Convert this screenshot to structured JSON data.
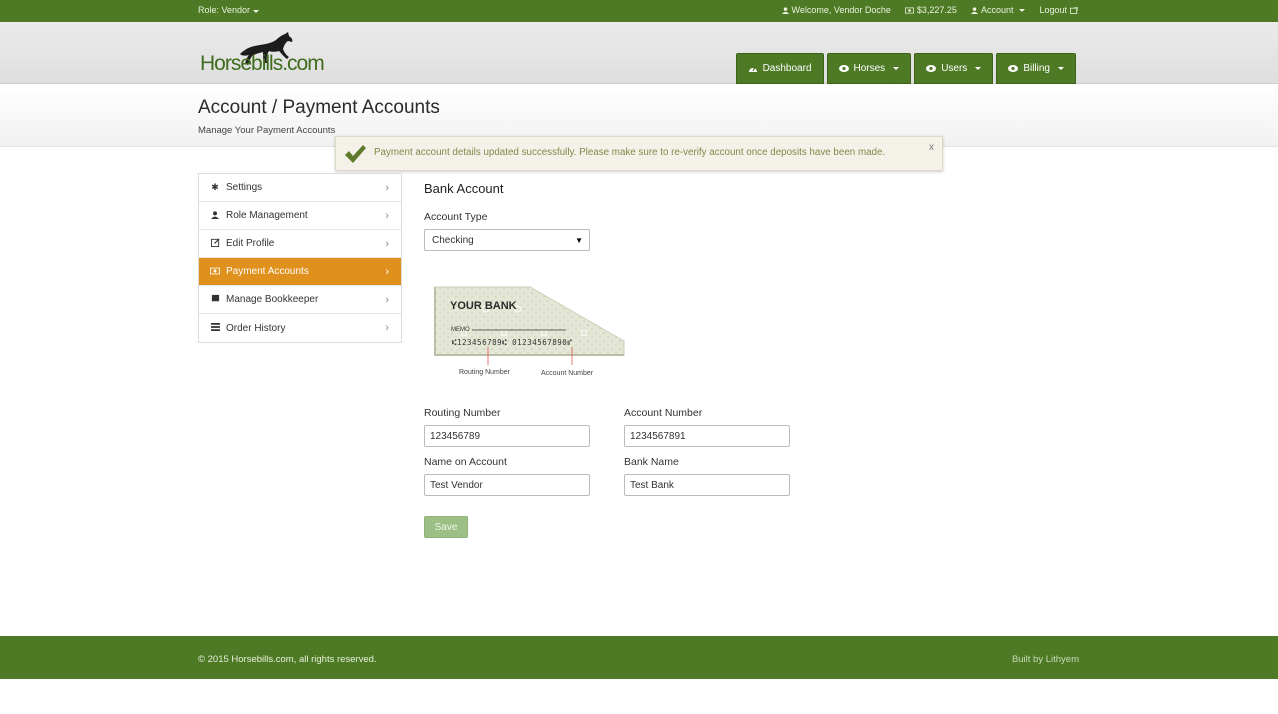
{
  "topbar": {
    "role": "Role: Vendor",
    "welcome": "Welcome, Vendor Doche",
    "balance": "$3,227.25",
    "account": "Account",
    "logout": "Logout"
  },
  "brand": {
    "logo_text": "Horsebills.com"
  },
  "nav": {
    "dashboard": "Dashboard",
    "horses": "Horses",
    "users": "Users",
    "billing": "Billing"
  },
  "page": {
    "title": "Account / Payment Accounts",
    "subtitle": "Manage Your Payment Accounts"
  },
  "alert": {
    "message": "Payment account details updated successfully. Please make sure to re-verify account once deposits have been made.",
    "close": "x"
  },
  "sidebar": {
    "items": [
      {
        "label": "Settings",
        "icon": "gear-icon"
      },
      {
        "label": "Role Management",
        "icon": "user-icon"
      },
      {
        "label": "Edit Profile",
        "icon": "edit-icon"
      },
      {
        "label": "Payment Accounts",
        "icon": "money-icon",
        "active": true
      },
      {
        "label": "Manage Bookkeeper",
        "icon": "book-icon"
      },
      {
        "label": "Order History",
        "icon": "list-icon"
      }
    ]
  },
  "form": {
    "heading": "Bank Account",
    "account_type_label": "Account Type",
    "account_type_value": "Checking",
    "routing_label": "Routing Number",
    "routing_value": "123456789",
    "account_number_label": "Account Number",
    "account_number_value": "1234567891",
    "name_label": "Name on Account",
    "name_value": "Test Vendor",
    "bank_label": "Bank Name",
    "bank_value": "Test Bank",
    "save_label": "Save"
  },
  "check_image": {
    "bank": "YOUR BANK",
    "memo": "MEMO",
    "micr": "⑆123456789⑆ 01234567890⑈",
    "routing_caption": "Routing Number",
    "account_caption": "Account Number"
  },
  "footer": {
    "copyright": "© 2015 Horsebills.com, all rights reserved.",
    "built_by": "Built by Lithyem"
  },
  "colors": {
    "brand_green": "#4e7a25",
    "active_orange": "#e0901c",
    "save_disabled": "#9cbf86"
  }
}
